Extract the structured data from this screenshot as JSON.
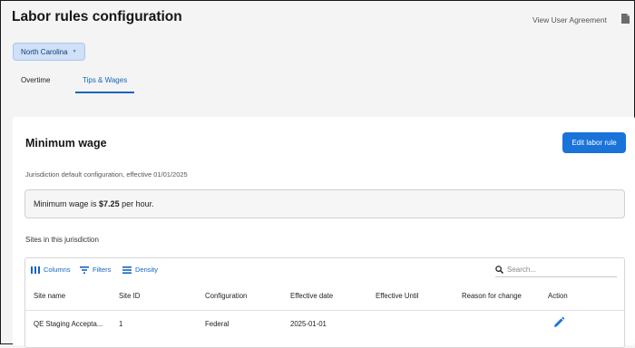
{
  "header": {
    "title": "Labor rules configuration",
    "view_agreement": "View User Agreement",
    "jurisdiction": "North Carolina"
  },
  "tabs": [
    {
      "label": "Overtime",
      "active": false
    },
    {
      "label": "Tips & Wages",
      "active": true
    }
  ],
  "card": {
    "title": "Minimum wage",
    "edit_button": "Edit labor rule",
    "config_note": "Jurisdiction default configuration, effective 01/01/2025",
    "min_wage_prefix": "Minimum wage is",
    "min_wage_value": "$7.25",
    "min_wage_suffix": "per hour.",
    "sites_heading": "Sites in this jurisdiction"
  },
  "grid": {
    "toolbar": {
      "columns": "Columns",
      "filters": "Filters",
      "density": "Density",
      "search_placeholder": "Search..."
    },
    "columns": [
      "Site name",
      "Site ID",
      "Configuration",
      "Effective date",
      "Effective Until",
      "Reason for change",
      "Action"
    ],
    "rows": [
      {
        "site_name": "QE Staging Accepta...",
        "site_id": "1",
        "configuration": "Federal",
        "effective_date": "2025-01-01",
        "effective_until": "",
        "reason": ""
      }
    ]
  },
  "colors": {
    "accent": "#1a73d9",
    "tab_active": "#1565c0",
    "select_bg": "#cfe0f7",
    "page_bg": "#f4f4f4"
  },
  "icons": [
    "document-icon",
    "chevron-down-icon",
    "columns-icon",
    "filter-icon",
    "density-icon",
    "search-icon",
    "pencil-icon"
  ]
}
